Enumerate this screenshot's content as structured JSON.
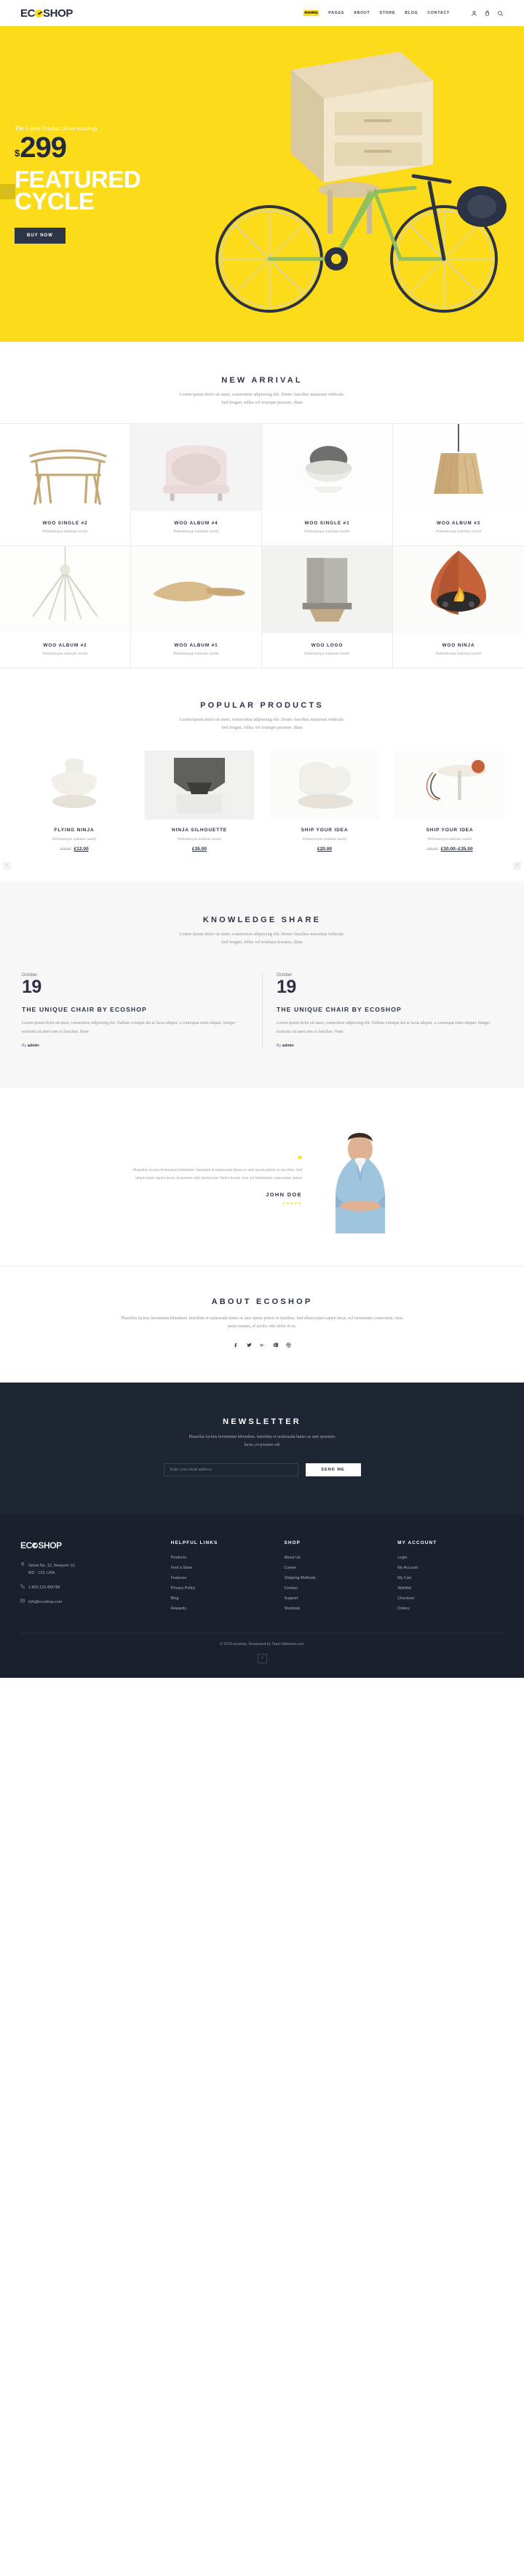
{
  "brand": {
    "name_part1": "EC",
    "name_part2": "SHOP",
    "full": "ECOSHOP"
  },
  "header": {
    "nav": [
      {
        "label": "HOME",
        "active": true
      },
      {
        "label": "PAGES",
        "active": false
      },
      {
        "label": "ABOUT",
        "active": false
      },
      {
        "label": "STORE",
        "active": false
      },
      {
        "label": "BLOG",
        "active": false
      },
      {
        "label": "CONTACT",
        "active": false
      }
    ],
    "icons": [
      "user-icon",
      "cart-icon",
      "search-icon"
    ]
  },
  "hero": {
    "kicker": "The Latest Product from ecoshop",
    "currency": "$",
    "price": "299",
    "title_line1": "FEATURED",
    "title_line2": "CYCLE",
    "button": "BUY NOW",
    "prev_arrow": "‹",
    "background_color": "#fcdb1b"
  },
  "new_arrival": {
    "title": "NEW ARRIVAL",
    "subtitle_line1": "Lorem ipsum dolor sit amet, consectetur adipiscing elit. Donec faucibus maximus vehicula.",
    "subtitle_line2": "Sed feugiat, tellus vel tristique posuere, diam",
    "products": [
      {
        "name": "WOO SINGLE #2",
        "desc": "Pellentesque habitant morbi"
      },
      {
        "name": "WOO ALBUM #4",
        "desc": "Pellentesque habitant morbi"
      },
      {
        "name": "WOO SINGLE #1",
        "desc": "Pellentesque habitant morbi"
      },
      {
        "name": "WOO ALBUM #3",
        "desc": "Pellentesque habitant morbi"
      },
      {
        "name": "WOO ALBUM #2",
        "desc": "Pellentesque habitant morbi"
      },
      {
        "name": "WOO ALBUM #1",
        "desc": "Pellentesque habitant morbi"
      },
      {
        "name": "WOO LOGO",
        "desc": "Pellentesque habitant morbi"
      },
      {
        "name": "WOO NINJA",
        "desc": "Pellentesque habitant morbi"
      }
    ]
  },
  "popular": {
    "title": "POPULAR PRODUCTS",
    "subtitle_line1": "Lorem ipsum dolor sit amet, consectetur adipiscing elit. Donec faucibus maximus vehicula.",
    "subtitle_line2": "Sed feugiat, tellus vel tristique posuere, diam",
    "prev_arrow": "‹",
    "next_arrow": "›",
    "items": [
      {
        "name": "FLYING NINJA",
        "desc": "Pellentesque habitant morbi",
        "old_price": "£15.00",
        "price": "£12.00",
        "currency": "£"
      },
      {
        "name": "NINJA SILHOUETTE",
        "desc": "Pellentesque habitant morbi",
        "old_price": "",
        "price": "£35.00",
        "currency": "£"
      },
      {
        "name": "SHIP YOUR IDEA",
        "desc": "Pellentesque habitant morbi",
        "old_price": "",
        "price": "£20.00",
        "currency": "£"
      },
      {
        "name": "SHIP YOUR IDEA",
        "desc": "Pellentesque habitant morbi",
        "old_price": "£36.00",
        "price": "£30.00–£35.00",
        "currency": "£"
      }
    ]
  },
  "knowledge": {
    "title": "KNOWLEDGE SHARE",
    "subtitle_line1": "Lorem ipsum dolor sit amet, consectetur adipiscing elit. Donec faucibus maximus vehicula.",
    "subtitle_line2": "Sed feugiat, tellus vel tristique posuere, diam",
    "posts": [
      {
        "month": "October",
        "day": "19",
        "title": "THE UNIQUE CHAIR BY ECOSHOP",
        "excerpt": "Lorem ipsum dolor sit amet, consectetur adipiscing elit. Nullam volutpat dui at lacus aliquet, a consequat enim aliquet. Integer molestie sit amet sem et faucibus. Nunc",
        "by_prefix": "By",
        "author": "admin"
      },
      {
        "month": "October",
        "day": "19",
        "title": "THE UNIQUE CHAIR BY ECOSHOP",
        "excerpt": "Lorem ipsum dolor sit amet, consectetur adipiscing elit. Nullam volutpat dui at lacus aliquet, a consequat enim aliquet. Integer molestie sit amet sem et faucibus. Nunc",
        "by_prefix": "By",
        "author": "admin"
      }
    ]
  },
  "testimonial": {
    "quote_mark": "❝",
    "text": "Phasellus lacinia fermentum bibendum. Interdum et malesuada fames ac ante ipsum primis in faucibus. Sed ullamcorper sapien lacus, in posuere odio luctus non. Nulla lacinia, eros vel fermentum consectetur, риsus",
    "name": "JOHN DOE",
    "stars": "★★★★★"
  },
  "about": {
    "title": "ABOUT ECOSHOP",
    "text": "Phasellus lacinia fermentum bibendum. Interdum et malesuada fames ac ante ipsum primis in faucibus. Sed ullamcorper sapien lacus, vel fermentum consectetur, risus purus tempus, el iaculis odio dolor in eu.",
    "social": [
      "facebook-icon",
      "twitter-icon",
      "google-plus-icon",
      "pinterest-icon",
      "dribbble-icon"
    ]
  },
  "newsletter": {
    "title": "NEWSLETTER",
    "text_line1": "Phasellus lacinia fermentum bibendum. Interdum et malesuada fames ac ante ipsumtes",
    "text_line2": "lacus, ex posuere odi",
    "input_placeholder": "Enter your email address",
    "button": "SEND ME"
  },
  "footer": {
    "address_icon": "location-pin-icon",
    "address_line1": "Street No. 12, Newyork 12,",
    "address_line2": "MD - 123, USA.",
    "phone_icon": "phone-icon",
    "phone": "1.800.123.456789",
    "email_icon": "mail-icon",
    "email": "info@ecoshop.com",
    "columns": [
      {
        "heading": "HELPFUL LINKS",
        "links": [
          "Products",
          "Find a Store",
          "Features",
          "Privacy Policy",
          "Blog",
          "Rewards"
        ]
      },
      {
        "heading": "SHOP",
        "links": [
          "About Us",
          "Career",
          "Shipping Methods",
          "Contact",
          "Support",
          "Stockists"
        ]
      },
      {
        "heading": "MY ACCOUNT",
        "links": [
          "Login",
          "My Account",
          "My Cart",
          "Wishlist",
          "Checkout",
          "Orders"
        ]
      }
    ],
    "copyright": "© 2018 ecoshop. Developed by Team Webstrot.com",
    "back_to_top": "↑"
  }
}
